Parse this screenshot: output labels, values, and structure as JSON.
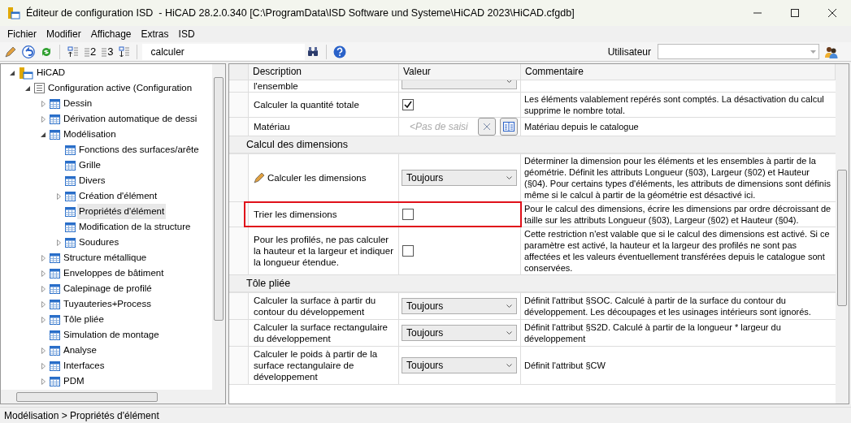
{
  "window": {
    "title": "Éditeur de configuration ISD  - HiCAD 28.2.0.340 [C:\\ProgramData\\ISD Software und Systeme\\HiCAD 2023\\HiCAD.cfgdb]"
  },
  "menu": [
    "Fichier",
    "Modifier",
    "Affichage",
    "Extras",
    "ISD"
  ],
  "toolbar": {
    "tools": [
      {
        "kind": "pencil"
      },
      {
        "kind": "undo"
      },
      {
        "kind": "refresh"
      },
      {
        "kind": "level-up"
      },
      {
        "kind": "level",
        "label": "2"
      },
      {
        "kind": "level",
        "label": "3"
      },
      {
        "kind": "level-down"
      }
    ],
    "search": {
      "value": "calculer"
    },
    "user_label": "Utilisateur"
  },
  "tree": [
    {
      "label": "HiCAD",
      "kind": "root",
      "expanded": true,
      "selected": false,
      "children": [
        {
          "label": "Configuration active (Configuration",
          "kind": "list",
          "expanded": true,
          "selected": false,
          "children": [
            {
              "label": "Dessin",
              "kind": "table",
              "expanded": false,
              "selected": false
            },
            {
              "label": "Dérivation automatique de dessi",
              "kind": "table",
              "expanded": false,
              "selected": false
            },
            {
              "label": "Modélisation",
              "kind": "table",
              "expanded": true,
              "selected": false,
              "children": [
                {
                  "label": "Fonctions des surfaces/arête",
                  "kind": "table",
                  "selected": false
                },
                {
                  "label": "Grille",
                  "kind": "table",
                  "selected": false
                },
                {
                  "label": "Divers",
                  "kind": "table",
                  "selected": false
                },
                {
                  "label": "Création d'élément",
                  "kind": "table",
                  "expanded": false,
                  "selected": false
                },
                {
                  "label": "Propriétés d'élément",
                  "kind": "table",
                  "selected": true
                },
                {
                  "label": "Modification de la structure",
                  "kind": "table",
                  "selected": false
                },
                {
                  "label": "Soudures",
                  "kind": "table",
                  "expanded": false,
                  "selected": false
                }
              ]
            },
            {
              "label": "Structure métallique",
              "kind": "table",
              "expanded": false,
              "selected": false
            },
            {
              "label": "Enveloppes de bâtiment",
              "kind": "table",
              "expanded": false,
              "selected": false
            },
            {
              "label": "Calepinage de profilé",
              "kind": "table",
              "expanded": false,
              "selected": false
            },
            {
              "label": "Tuyauteries+Process",
              "kind": "table",
              "expanded": false,
              "selected": false
            },
            {
              "label": "Tôle pliée",
              "kind": "table",
              "expanded": false,
              "selected": false
            },
            {
              "label": "Simulation de montage",
              "kind": "table",
              "selected": false
            },
            {
              "label": "Analyse",
              "kind": "table",
              "expanded": false,
              "selected": false
            },
            {
              "label": "Interfaces",
              "kind": "table",
              "expanded": false,
              "selected": false
            },
            {
              "label": "PDM",
              "kind": "table",
              "expanded": false,
              "selected": false
            }
          ]
        }
      ]
    }
  ],
  "grid": {
    "columns": [
      "Description",
      "Valeur",
      "Commentaire"
    ],
    "rows": [
      {
        "kind": "partial",
        "description": "l'ensemble",
        "value": {
          "kind": "dropdown"
        }
      },
      {
        "kind": "setting",
        "description": "Calculer la quantité totale",
        "modified": false,
        "highlighted": false,
        "value": {
          "kind": "checkbox",
          "checked": true
        },
        "comment": "Les éléments valablement repérés sont comptés. La désactivation du calcul supprime le nombre total."
      },
      {
        "kind": "setting",
        "description": "Matériau",
        "modified": false,
        "highlighted": false,
        "value": {
          "kind": "picker",
          "placeholder": "<Pas de saisi"
        },
        "comment": "Matériau depuis le catalogue"
      },
      {
        "kind": "group",
        "label": "Calcul des dimensions"
      },
      {
        "kind": "setting",
        "description": "Calculer les dimensions",
        "modified": true,
        "highlighted": false,
        "value": {
          "kind": "dropdown",
          "text": "Toujours"
        },
        "comment": "Déterminer la dimension pour les éléments et les ensembles à partir de la géométrie. Définit les attributs Longueur (§03), Largeur (§02) et Hauteur (§04). Pour certains types d'éléments, les attributs de dimensions sont définis même si le calcul à partir de la géométrie est désactivé ici."
      },
      {
        "kind": "setting",
        "description": "Trier les dimensions",
        "modified": false,
        "highlighted": true,
        "value": {
          "kind": "checkbox",
          "checked": false
        },
        "comment": "Pour le calcul des dimensions, écrire les dimensions par ordre décroissant de taille sur les attributs Longueur (§03), Largeur (§02) et Hauteur (§04)."
      },
      {
        "kind": "setting",
        "description": "Pour les profilés, ne pas calculer la hauteur et la largeur et indiquer la longueur étendue.",
        "modified": false,
        "highlighted": false,
        "value": {
          "kind": "checkbox",
          "checked": false
        },
        "comment": "Cette restriction n'est valable que si le calcul des dimensions est activé. Si ce paramètre est activé, la hauteur et la largeur des profilés ne sont pas affectées et les valeurs éventuellement transférées depuis le catalogue sont conservées."
      },
      {
        "kind": "group",
        "label": "Tôle pliée"
      },
      {
        "kind": "setting",
        "description": "Calculer la surface à partir du contour du développement",
        "modified": false,
        "highlighted": false,
        "value": {
          "kind": "dropdown",
          "text": "Toujours"
        },
        "comment": "Définit l'attribut §SOC. Calculé à partir de la surface du contour du développement. Les découpages et les usinages intérieurs sont ignorés."
      },
      {
        "kind": "setting",
        "description": "Calculer la surface rectangulaire du développement",
        "modified": false,
        "highlighted": false,
        "value": {
          "kind": "dropdown",
          "text": "Toujours"
        },
        "comment": "Définit l'attribut §S2D. Calculé à partir de la longueur * largeur du développement"
      },
      {
        "kind": "setting",
        "description": "Calculer le poids à partir de la surface rectangulaire de développement",
        "modified": false,
        "highlighted": false,
        "value": {
          "kind": "dropdown",
          "text": "Toujours"
        },
        "comment": "Définit l'attribut §CW"
      }
    ]
  },
  "status_bar": "Modélisation > Propriétés d'élément"
}
